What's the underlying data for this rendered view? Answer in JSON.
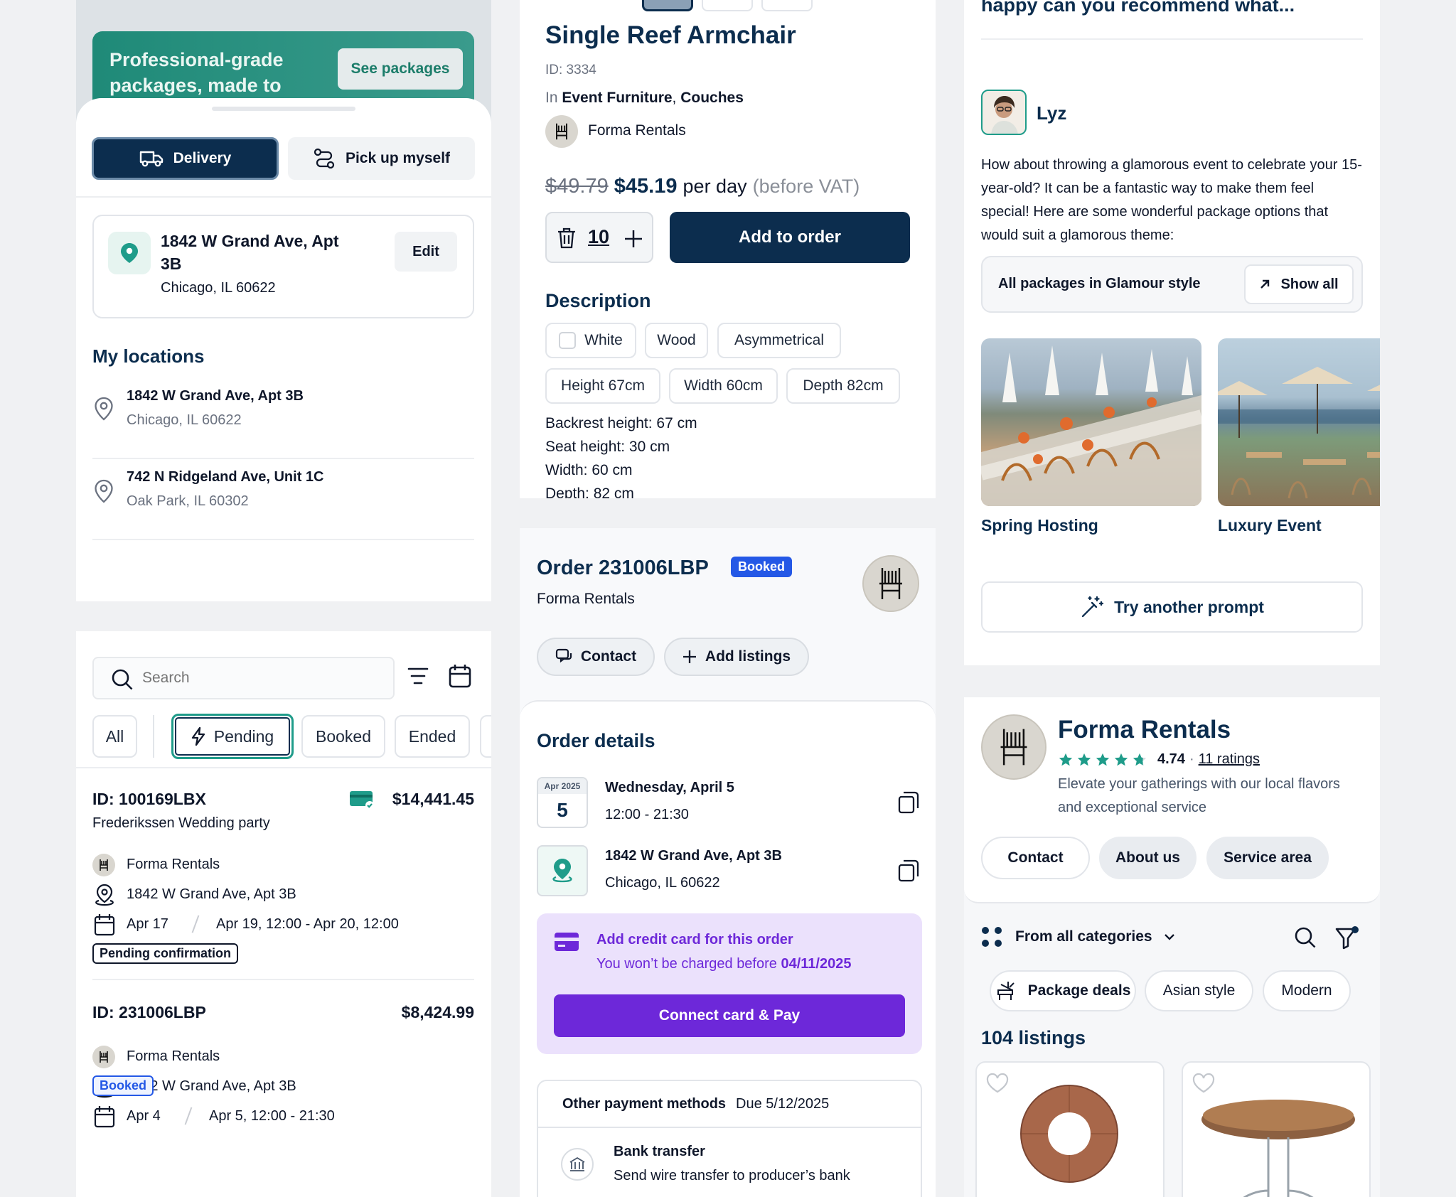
{
  "delivery": {
    "banner_text": "Professional-grade packages, made to",
    "banner_button": "See packages",
    "tabs": {
      "delivery": "Delivery",
      "pickup": "Pick up myself"
    },
    "address": {
      "line1": "1842 W Grand Ave, Apt",
      "line2": "3B",
      "line3": "Chicago, IL 60622",
      "edit_label": "Edit"
    },
    "my_locations_title": "My locations",
    "locations": [
      {
        "line1": "1842 W Grand Ave, Apt 3B",
        "line2": "Chicago, IL 60622"
      },
      {
        "line1": "742 N Ridgeland Ave, Unit 1C",
        "line2": "Oak Park, IL 60302"
      }
    ]
  },
  "orders": {
    "search_placeholder": "Search",
    "filters": [
      "All",
      "Pending",
      "Booked",
      "Ended"
    ],
    "items": [
      {
        "id": "ID: 100169LBX",
        "price": "$14,441.45",
        "name": "Frederikssen Wedding party",
        "vendor": "Forma Rentals",
        "address": "1842 W Grand Ave, Apt 3B",
        "date_start": "Apr 17",
        "date_range": "Apr 19, 12:00 - Apr 20, 12:00",
        "status": "Pending confirmation"
      },
      {
        "id": "ID: 231006LBP",
        "price": "$8,424.99",
        "vendor": "Forma Rentals",
        "address": "1842 W Grand Ave, Apt 3B",
        "date_start": "Apr 4",
        "date_range": "Apr 5, 12:00 - 21:30",
        "status": "Booked"
      }
    ]
  },
  "product": {
    "title": "Single Reef Armchair",
    "id": "ID: 3334",
    "in_label": "In",
    "category1": "Event Furniture",
    "category_sep": ",",
    "category2": "Couches",
    "vendor": "Forma Rentals",
    "old_price": "$49.79",
    "price": "$45.19",
    "per": "per day",
    "vat": "(before VAT)",
    "quantity": "10",
    "add_button": "Add to order",
    "description_title": "Description",
    "tags": [
      "White",
      "Wood",
      "Asymmetrical"
    ],
    "dims": [
      "Height 67cm",
      "Width 60cm",
      "Depth 82cm"
    ],
    "specs": [
      "Backrest height: 67 cm",
      "Seat height: 30 cm",
      "Width: 60 cm",
      "Depth: 82 cm"
    ]
  },
  "order": {
    "title": "Order 231006LBP",
    "badge": "Booked",
    "vendor": "Forma Rentals",
    "contact": "Contact",
    "add_listings": "Add listings",
    "details_title": "Order details",
    "cal_month": "Apr 2025",
    "cal_day": "5",
    "date": "Wednesday, April 5",
    "time": "12:00 - 21:30",
    "address1": "1842 W Grand Ave, Apt 3B",
    "address2": "Chicago, IL 60622",
    "card_title": "Add credit card for this order",
    "card_sub": "You won’t be charged before",
    "card_date": "04/11/2025",
    "pay_button": "Connect card & Pay",
    "other_title": "Other payment methods",
    "due": "Due 5/12/2025",
    "bank_title": "Bank transfer",
    "bank_sub": "Send wire transfer to producer’s bank"
  },
  "chat": {
    "question": "happy can you recommend what...",
    "name": "Lyz",
    "message": "How about throwing a glamorous event to celebrate your 15-year-old? It can be a fantastic way to make them feel special! Here are some wonderful package options that would suit a glamorous theme:",
    "packages_label": "All packages in Glamour style",
    "show_all": "Show all",
    "cards": [
      "Spring Hosting",
      "Luxury Event"
    ],
    "try_another": "Try another prompt"
  },
  "vendor": {
    "name": "Forma Rentals",
    "rating": "4.74",
    "rating_sep": "·",
    "ratings_link": "11 ratings",
    "rating_value": 4.74,
    "tagline": "Elevate your gatherings with our local flavors and exceptional service",
    "buttons": [
      "Contact",
      "About us",
      "Service area"
    ],
    "categories_label": "From all categories",
    "filter_chips": [
      "Package deals",
      "Asian style",
      "Modern"
    ],
    "listings_count": "104 listings"
  },
  "colors": {
    "navy": "#0c2d4e",
    "teal": "#1f9c8a",
    "purple": "#6d28d9",
    "blue": "#2458e6"
  }
}
